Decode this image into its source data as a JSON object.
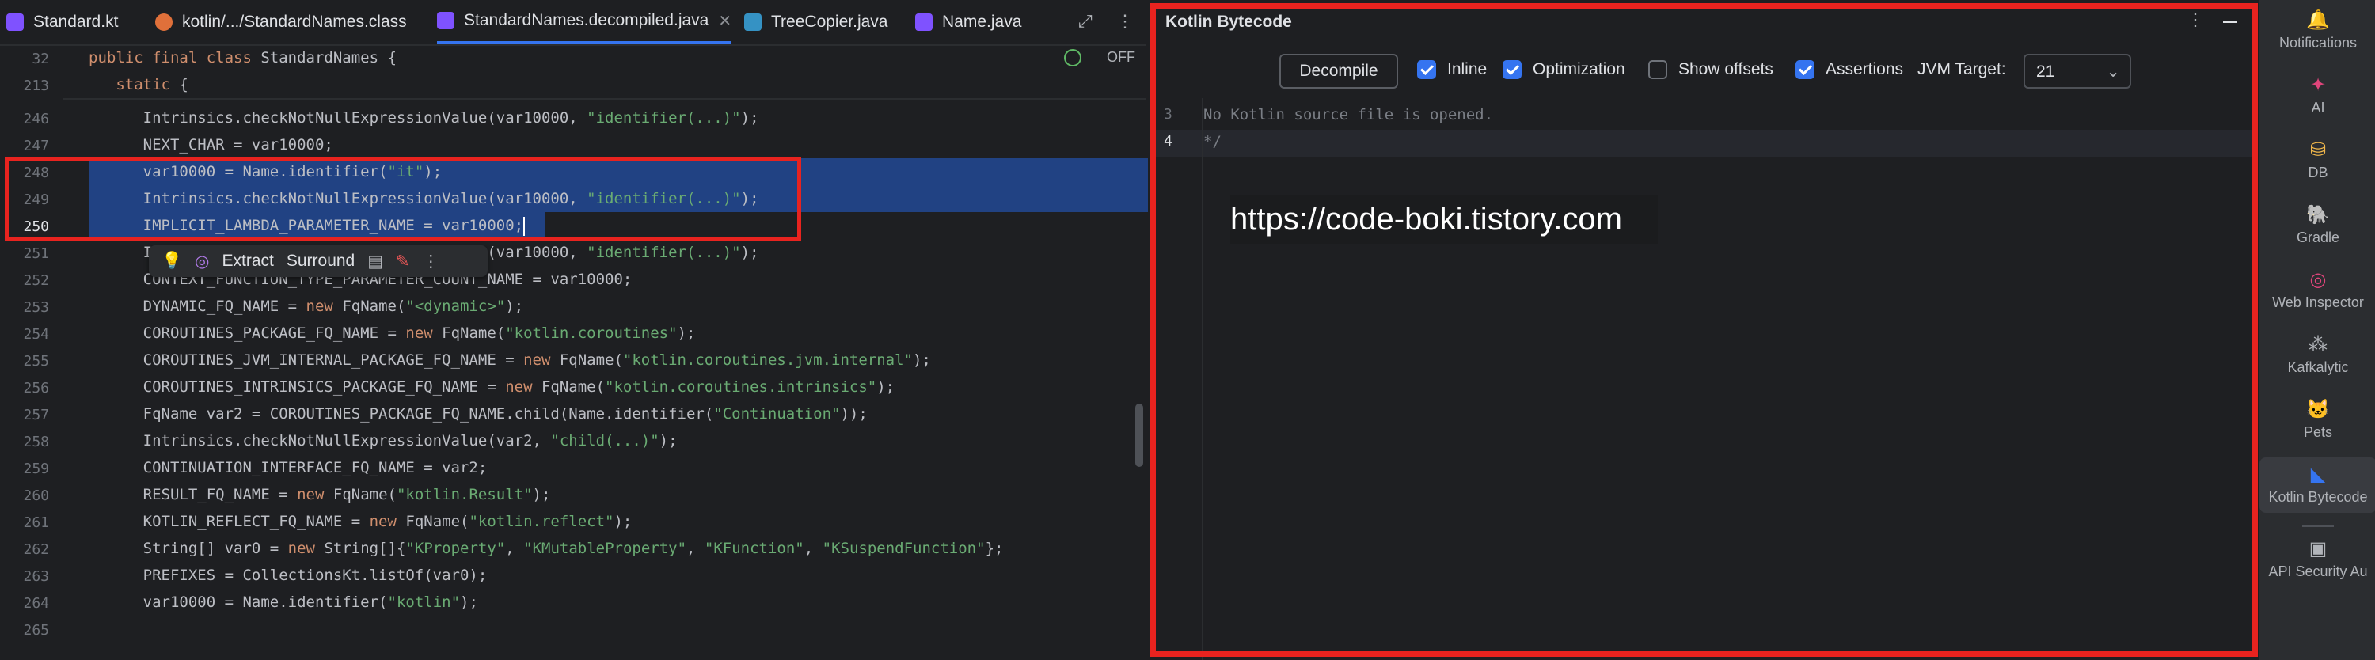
{
  "editor": {
    "tabs": [
      {
        "label": "Standard.kt",
        "icon": "kotlin-file-icon",
        "color": "#7f52ff"
      },
      {
        "label": "kotlin/.../StandardNames.class",
        "icon": "class-file-icon",
        "color": "#e0703a"
      },
      {
        "label": "StandardNames.decompiled.java",
        "icon": "java-file-icon",
        "color": "#7f52ff",
        "active": true
      },
      {
        "label": "TreeCopier.java",
        "icon": "java-file-icon",
        "color": "#3592c4"
      },
      {
        "label": "Name.java",
        "icon": "java-file-icon",
        "color": "#7f52ff"
      }
    ],
    "tab_close": "✕",
    "sticky_lines": [
      {
        "num": "32",
        "parts": [
          {
            "t": "public final class ",
            "k": "kw"
          },
          {
            "t": "StandardNames {",
            "k": ""
          }
        ]
      },
      {
        "num": "213",
        "parts": [
          {
            "t": "   static ",
            "k": "kw"
          },
          {
            "t": "{",
            "k": ""
          }
        ]
      }
    ],
    "inspection_toggle": "OFF",
    "lines": [
      {
        "num": "246",
        "parts": [
          {
            "t": "      Intrinsics.checkNotNullExpressionValue(var10000, ",
            "k": ""
          },
          {
            "t": "\"identifier(...)\"",
            "k": "str"
          },
          {
            "t": ");",
            "k": ""
          }
        ]
      },
      {
        "num": "247",
        "parts": [
          {
            "t": "      NEXT_CHAR = var10000;",
            "k": ""
          }
        ]
      },
      {
        "num": "248",
        "parts": [
          {
            "t": "      var10000 = Name.identifier(",
            "k": ""
          },
          {
            "t": "\"it\"",
            "k": "str"
          },
          {
            "t": ");",
            "k": ""
          }
        ]
      },
      {
        "num": "249",
        "parts": [
          {
            "t": "      Intrinsics.checkNotNullExpressionValue(var10000, ",
            "k": ""
          },
          {
            "t": "\"identifier(...)\"",
            "k": "str"
          },
          {
            "t": ");",
            "k": ""
          }
        ]
      },
      {
        "num": "250",
        "parts": [
          {
            "t": "      IMPLICIT_LAMBDA_PARAMETER_NAME = var10000;",
            "k": ""
          }
        ]
      },
      {
        "num": "251",
        "parts": [
          {
            "t": "      Intrinsics.checkNotNullExpressionValue(var10000, ",
            "k": ""
          },
          {
            "t": "\"identifier(...)\"",
            "k": "str"
          },
          {
            "t": ");",
            "k": ""
          }
        ]
      },
      {
        "num": "252",
        "parts": [
          {
            "t": "      CONTEXT_FUNCTION_TYPE_PARAMETER_COUNT_NAME = var10000;",
            "k": ""
          }
        ]
      },
      {
        "num": "253",
        "parts": [
          {
            "t": "      DYNAMIC_FQ_NAME = ",
            "k": ""
          },
          {
            "t": "new ",
            "k": "kw"
          },
          {
            "t": "FqName(",
            "k": ""
          },
          {
            "t": "\"<dynamic>\"",
            "k": "str"
          },
          {
            "t": ");",
            "k": ""
          }
        ]
      },
      {
        "num": "254",
        "parts": [
          {
            "t": "      COROUTINES_PACKAGE_FQ_NAME = ",
            "k": ""
          },
          {
            "t": "new ",
            "k": "kw"
          },
          {
            "t": "FqName(",
            "k": ""
          },
          {
            "t": "\"kotlin.coroutines\"",
            "k": "str"
          },
          {
            "t": ");",
            "k": ""
          }
        ]
      },
      {
        "num": "255",
        "parts": [
          {
            "t": "      COROUTINES_JVM_INTERNAL_PACKAGE_FQ_NAME = ",
            "k": ""
          },
          {
            "t": "new ",
            "k": "kw"
          },
          {
            "t": "FqName(",
            "k": ""
          },
          {
            "t": "\"kotlin.coroutines.jvm.internal\"",
            "k": "str"
          },
          {
            "t": ");",
            "k": ""
          }
        ]
      },
      {
        "num": "256",
        "parts": [
          {
            "t": "      COROUTINES_INTRINSICS_PACKAGE_FQ_NAME = ",
            "k": ""
          },
          {
            "t": "new ",
            "k": "kw"
          },
          {
            "t": "FqName(",
            "k": ""
          },
          {
            "t": "\"kotlin.coroutines.intrinsics\"",
            "k": "str"
          },
          {
            "t": ");",
            "k": ""
          }
        ]
      },
      {
        "num": "257",
        "parts": [
          {
            "t": "      FqName var2 = COROUTINES_PACKAGE_FQ_NAME.child(Name.identifier(",
            "k": ""
          },
          {
            "t": "\"Continuation\"",
            "k": "str"
          },
          {
            "t": "));",
            "k": ""
          }
        ]
      },
      {
        "num": "258",
        "parts": [
          {
            "t": "      Intrinsics.checkNotNullExpressionValue(var2, ",
            "k": ""
          },
          {
            "t": "\"child(...)\"",
            "k": "str"
          },
          {
            "t": ");",
            "k": ""
          }
        ]
      },
      {
        "num": "259",
        "parts": [
          {
            "t": "      CONTINUATION_INTERFACE_FQ_NAME = var2;",
            "k": ""
          }
        ]
      },
      {
        "num": "260",
        "parts": [
          {
            "t": "      RESULT_FQ_NAME = ",
            "k": ""
          },
          {
            "t": "new ",
            "k": "kw"
          },
          {
            "t": "FqName(",
            "k": ""
          },
          {
            "t": "\"kotlin.Result\"",
            "k": "str"
          },
          {
            "t": ");",
            "k": ""
          }
        ]
      },
      {
        "num": "261",
        "parts": [
          {
            "t": "      KOTLIN_REFLECT_FQ_NAME = ",
            "k": ""
          },
          {
            "t": "new ",
            "k": "kw"
          },
          {
            "t": "FqName(",
            "k": ""
          },
          {
            "t": "\"kotlin.reflect\"",
            "k": "str"
          },
          {
            "t": ");",
            "k": ""
          }
        ]
      },
      {
        "num": "262",
        "parts": [
          {
            "t": "      String[] var0 = ",
            "k": ""
          },
          {
            "t": "new ",
            "k": "kw"
          },
          {
            "t": "String[]{",
            "k": ""
          },
          {
            "t": "\"KProperty\"",
            "k": "str"
          },
          {
            "t": ", ",
            "k": ""
          },
          {
            "t": "\"KMutableProperty\"",
            "k": "str"
          },
          {
            "t": ", ",
            "k": ""
          },
          {
            "t": "\"KFunction\"",
            "k": "str"
          },
          {
            "t": ", ",
            "k": ""
          },
          {
            "t": "\"KSuspendFunction\"",
            "k": "str"
          },
          {
            "t": "};",
            "k": ""
          }
        ]
      },
      {
        "num": "263",
        "parts": [
          {
            "t": "      PREFIXES = CollectionsKt.listOf(var0);",
            "k": ""
          }
        ]
      },
      {
        "num": "264",
        "parts": [
          {
            "t": "      var10000 = Name.identifier(",
            "k": ""
          },
          {
            "t": "\"kotlin\"",
            "k": "str"
          },
          {
            "t": ");",
            "k": ""
          }
        ]
      },
      {
        "num": "265",
        "parts": []
      }
    ],
    "selected_lines": [
      "248",
      "249",
      "250"
    ],
    "current_line": "250",
    "floating_toolbar": {
      "extract": "Extract",
      "surround": "Surround"
    }
  },
  "panel": {
    "title": "Kotlin Bytecode",
    "decompile_label": "Decompile",
    "options": [
      {
        "label": "Inline",
        "checked": true
      },
      {
        "label": "Optimization",
        "checked": true
      },
      {
        "label": "Show offsets",
        "checked": false
      },
      {
        "label": "Assertions",
        "checked": true
      }
    ],
    "jvm_target_label": "JVM Target:",
    "jvm_target_value": "21",
    "lines": [
      {
        "num": "3",
        "text": "No Kotlin source file is opened."
      },
      {
        "num": "4",
        "text": "*/"
      }
    ],
    "watermark": "https://code-boki.tistory.com"
  },
  "right_strip": [
    {
      "label": "Notifications",
      "icon": "bell-icon",
      "glyph": "🔔"
    },
    {
      "label": "AI",
      "icon": "ai-assistant-icon",
      "glyph": "✦"
    },
    {
      "label": "DB",
      "icon": "database-icon",
      "glyph": "⛁"
    },
    {
      "label": "Gradle",
      "icon": "gradle-elephant-icon",
      "glyph": "🐘"
    },
    {
      "label": "Web Inspector",
      "icon": "web-inspector-icon",
      "glyph": "◎"
    },
    {
      "label": "Kafkalytic",
      "icon": "kafkalytic-icon",
      "glyph": "⁂"
    },
    {
      "label": "Pets",
      "icon": "pets-icon",
      "glyph": "🐱"
    },
    {
      "label": "Kotlin Bytecode",
      "icon": "kotlin-bytecode-icon",
      "glyph": "◣",
      "selected": true
    },
    {
      "label": "API Security Au",
      "icon": "api-security-icon",
      "glyph": "▣"
    }
  ],
  "colors": {
    "annotation": "#e8231f",
    "accent": "#3574f0",
    "selection": "#214283"
  }
}
